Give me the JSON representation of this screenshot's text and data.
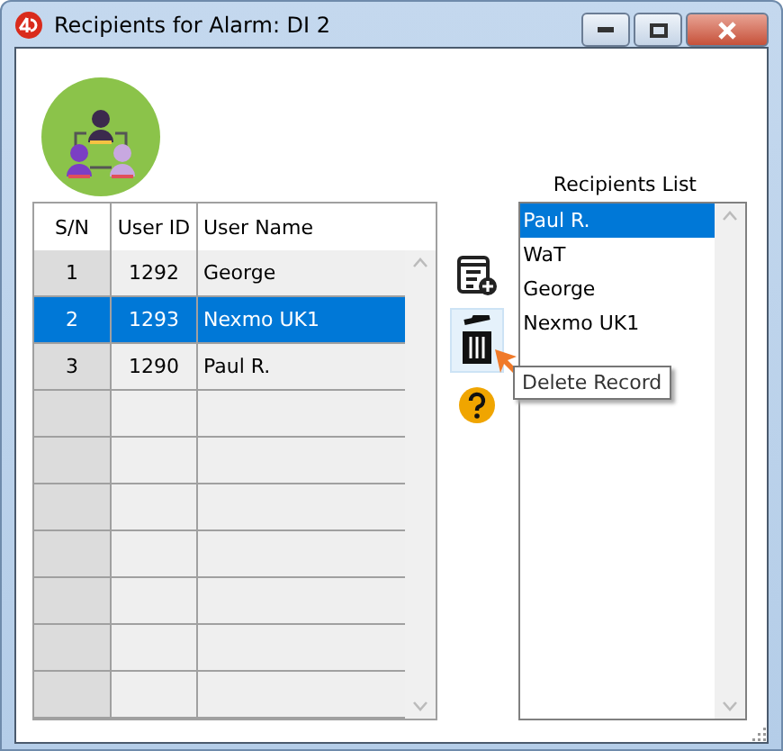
{
  "window": {
    "title": "Recipients for Alarm: DI 2"
  },
  "users_table": {
    "columns": [
      "S/N",
      "User ID",
      "User Name"
    ],
    "rows": [
      {
        "sn": "1",
        "user_id": "1292",
        "user_name": "George",
        "selected": false
      },
      {
        "sn": "2",
        "user_id": "1293",
        "user_name": "Nexmo UK1",
        "selected": true
      },
      {
        "sn": "3",
        "user_id": "1290",
        "user_name": "Paul R.",
        "selected": false
      }
    ]
  },
  "actions": [
    {
      "kind": "add",
      "highlighted": false
    },
    {
      "kind": "delete",
      "highlighted": true
    },
    {
      "kind": "help",
      "highlighted": false
    }
  ],
  "tooltip": {
    "text": "Delete Record"
  },
  "recipients": {
    "label": "Recipients List",
    "items": [
      {
        "name": "Paul R.",
        "selected": true
      },
      {
        "name": "WaT",
        "selected": false
      },
      {
        "name": "George",
        "selected": false
      },
      {
        "name": "Nexmo UK1",
        "selected": false
      }
    ]
  }
}
